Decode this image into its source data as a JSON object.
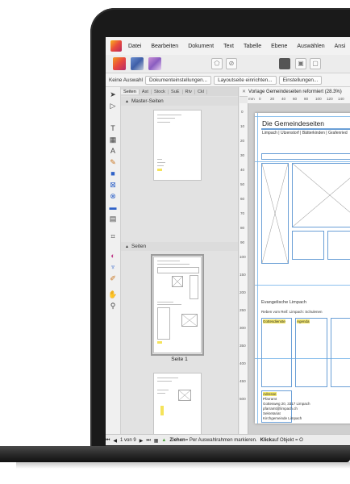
{
  "menu": [
    "Datei",
    "Bearbeiten",
    "Dokument",
    "Text",
    "Tabelle",
    "Ebene",
    "Auswählen",
    "Ansi"
  ],
  "context": {
    "selection": "Keine Auswahl",
    "buttons": [
      "Dokumenteinstellungen...",
      "Layoutseite einrichten...",
      "Einstellungen..."
    ]
  },
  "panel": {
    "tabs": [
      "Seiten",
      "Ast",
      "Stock",
      "SuE",
      "Rtv",
      "Ckl"
    ],
    "master_header": "Master-Seiten",
    "pages_header": "Seiten",
    "selected_caption": "Seite 1"
  },
  "document": {
    "tab_title": "Vorlage Gemeindeseiten reformiert (28.3%)",
    "page_title": "Die Gemeindeseiten",
    "page_subtitle": "Limpach | Utzenstorf | Bätterkinden | Grafenried",
    "section_heading": "Evangelische Limpach",
    "section_sub": "Reben vom Reif: Limpach: Schulenen",
    "col1_label": "Gottesdienste",
    "col2_label": "Agenda",
    "address_lines": [
      "Adresse",
      "Pfarramt",
      "Gottesweg 20, 3317 Limpach",
      "pfarramt@limpach.ch",
      "Sekretariat",
      "Kirchgemeinde Limpach"
    ]
  },
  "ruler": {
    "unit": "mm",
    "h_ticks": [
      "0",
      "20",
      "40",
      "60",
      "80",
      "100",
      "120",
      "140"
    ],
    "v_ticks": [
      "0",
      "10",
      "20",
      "30",
      "40",
      "50",
      "60",
      "70",
      "80",
      "90",
      "100",
      "150",
      "200",
      "250",
      "300",
      "350",
      "400",
      "450",
      "500"
    ]
  },
  "status": {
    "page_position": "1 von 9",
    "hint_bold_1": "Ziehen",
    "hint_text_1": "= Per Auswahlrahmen markieren.",
    "hint_bold_2": "Klick",
    "hint_text_2": "auf Objekt = O"
  },
  "colors": {
    "guide": "#6fb0e8",
    "frame": "#6a9fd6",
    "highlight": "#f4e86a"
  },
  "icons": [
    "app-logo-icon",
    "publisher-persona-icon",
    "designer-persona-icon",
    "photo-persona-icon",
    "pointer-tool-icon",
    "node-tool-icon",
    "text-tool-icon",
    "pen-tool-icon",
    "shape-tool-icon",
    "picture-frame-icon",
    "hand-tool-icon",
    "zoom-tool-icon"
  ]
}
